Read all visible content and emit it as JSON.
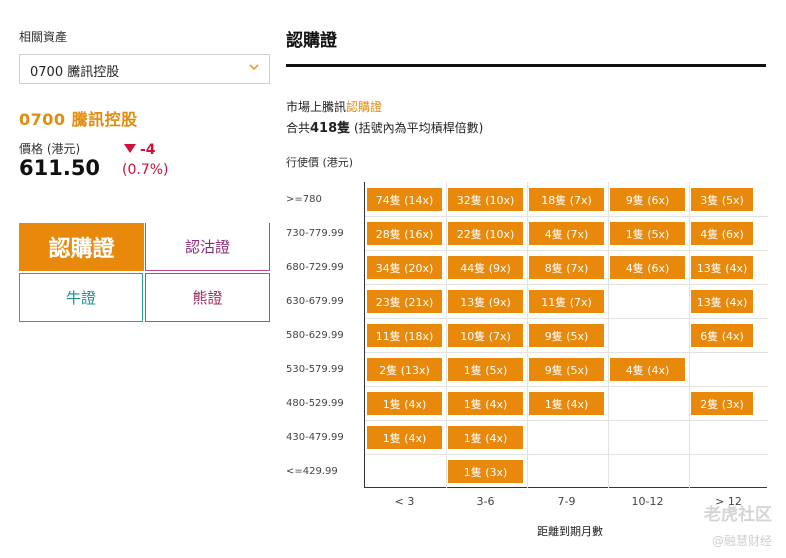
{
  "sidebar": {
    "related_label": "相關資產",
    "select_value": "0700 騰訊控股",
    "stock_title": "0700 騰訊控股",
    "price_label": "價格 (港元)",
    "price_value": "611.50",
    "change_value": "-4",
    "change_pct": "(0.7%)",
    "tabs": [
      {
        "label": "認購證"
      },
      {
        "label": "認沽證"
      },
      {
        "label": "牛證"
      },
      {
        "label": "熊證"
      }
    ],
    "accent_color": "#e8890c",
    "down_color": "#d0103a"
  },
  "main": {
    "title": "認購證",
    "market_prefix": "市場上騰訊",
    "market_highlight": "認購證",
    "total_prefix": "合共",
    "total_count": "418隻",
    "total_suffix": " (括號內為平均槓桿倍數)",
    "strike_label": "行使價 (港元)",
    "x_axis_title": "距離到期月數"
  },
  "grid": {
    "row_labels": [
      ">=780",
      "730-779.99",
      "680-729.99",
      "630-679.99",
      "580-629.99",
      "530-579.99",
      "480-529.99",
      "430-479.99",
      "<=429.99"
    ],
    "col_labels": [
      "< 3",
      "3-6",
      "7-9",
      "10-12",
      "> 12"
    ],
    "cells": [
      [
        "74隻 (14x)",
        "32隻 (10x)",
        "18隻 (7x)",
        "9隻 (6x)",
        "3隻 (5x)"
      ],
      [
        "28隻 (16x)",
        "22隻 (10x)",
        "4隻 (7x)",
        "1隻 (5x)",
        "4隻 (6x)"
      ],
      [
        "34隻 (20x)",
        "44隻 (9x)",
        "8隻 (7x)",
        "4隻 (6x)",
        "13隻 (4x)"
      ],
      [
        "23隻 (21x)",
        "13隻 (9x)",
        "11隻 (7x)",
        "",
        "13隻 (4x)"
      ],
      [
        "11隻 (18x)",
        "10隻 (7x)",
        "9隻 (5x)",
        "",
        "6隻 (4x)"
      ],
      [
        "2隻 (13x)",
        "1隻 (5x)",
        "9隻 (5x)",
        "4隻 (4x)",
        ""
      ],
      [
        "1隻 (4x)",
        "1隻 (4x)",
        "1隻 (4x)",
        "",
        "2隻 (3x)"
      ],
      [
        "1隻 (4x)",
        "1隻 (4x)",
        "",
        "",
        ""
      ],
      [
        "",
        "1隻 (3x)",
        "",
        "",
        ""
      ]
    ]
  },
  "watermark": {
    "brand": "老虎社区",
    "handle": "@融慧财经"
  }
}
